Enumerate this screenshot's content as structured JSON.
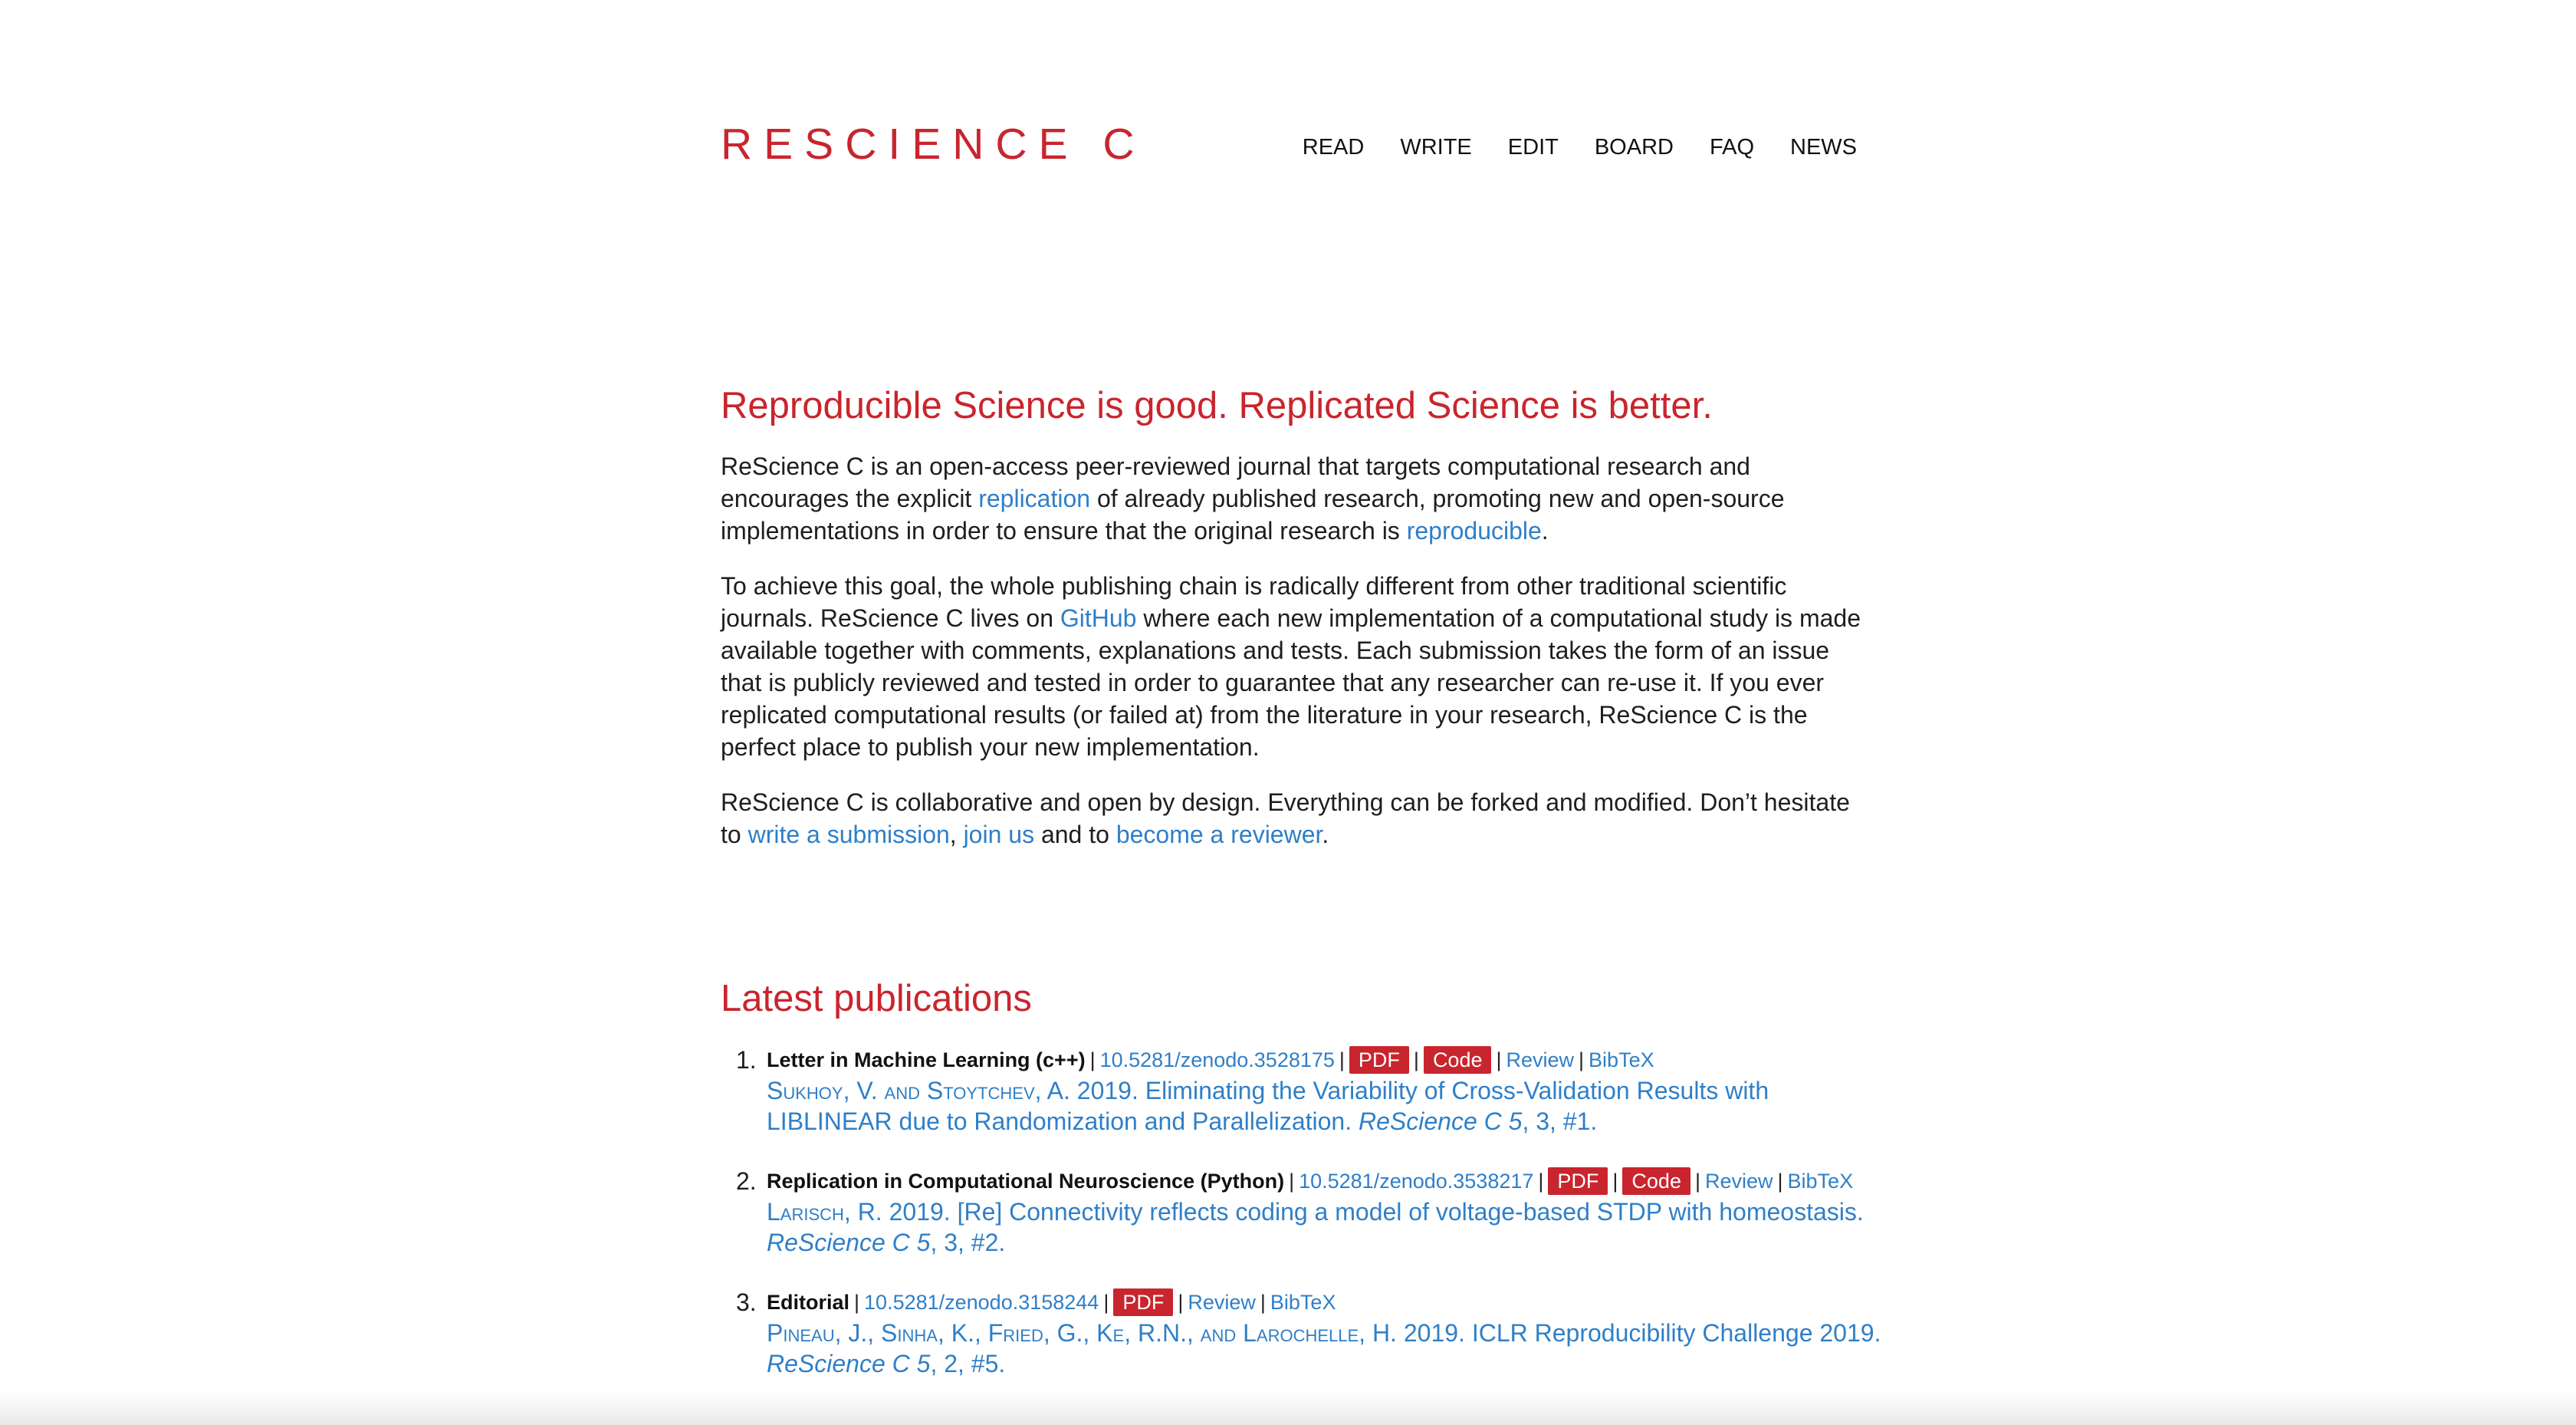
{
  "header": {
    "logo": "RESCIENCE C",
    "nav": [
      "READ",
      "WRITE",
      "EDIT",
      "BOARD",
      "FAQ",
      "NEWS"
    ]
  },
  "intro": {
    "title": "Reproducible Science is good. Replicated Science is better.",
    "p1": {
      "t1": "ReScience C is an open-access peer-reviewed journal that targets computational research and encourages the explicit ",
      "link1": "replication",
      "t2": " of already published research, promoting new and open-source implementations in order to ensure that the original research is ",
      "link2": "reproducible",
      "t3": "."
    },
    "p2": {
      "t1": "To achieve this goal, the whole publishing chain is radically different from other traditional scientific journals. ReScience C lives on ",
      "link1": "GitHub",
      "t2": " where each new implementation of a computational study is made available together with comments, explanations and tests. Each submission takes the form of an issue that is publicly reviewed and tested in order to guarantee that any researcher can re-use it. If you ever replicated computational results (or failed at) from the literature in your research, ReScience C is the perfect place to publish your new implementation."
    },
    "p3": {
      "t1": "ReScience C is collaborative and open by design. Everything can be forked and modified. Don’t hesitate to ",
      "link1": "write a submission",
      "t2": ", ",
      "link2": "join us",
      "t3": " and to ",
      "link3": "become a reviewer",
      "t4": "."
    }
  },
  "publications": {
    "title": "Latest publications",
    "items": [
      {
        "num": "1.",
        "category": "Letter in Machine Learning (c++)",
        "doi": "10.5281/zenodo.3528175",
        "pdf": "PDF",
        "code": "Code",
        "review": "Review",
        "bibtex": "BibTeX",
        "authors": "Sukhoy, V. and Stoytchev, A.",
        "year_title": " 2019. Eliminating the Variability of Cross-Validation Results with LIBLINEAR due to Randomization and Parallelization. ",
        "journal": "ReScience C 5",
        "issue": ", 3, #1."
      },
      {
        "num": "2.",
        "category": "Replication in Computational Neuroscience (Python)",
        "doi": "10.5281/zenodo.3538217",
        "pdf": "PDF",
        "code": "Code",
        "review": "Review",
        "bibtex": "BibTeX",
        "authors": "Larisch, R.",
        "year_title": " 2019. [Re] Connectivity reflects coding a model of voltage-based STDP with homeostasis. ",
        "journal": "ReScience C 5",
        "issue": ", 3, #2."
      },
      {
        "num": "3.",
        "category": "Editorial",
        "doi": "10.5281/zenodo.3158244",
        "pdf": "PDF",
        "review": "Review",
        "bibtex": "BibTeX",
        "authors": "Pineau, J., Sinha, K., Fried, G., Ke, R.N., and Larochelle, H.",
        "year_title": " 2019. ICLR Reproducibility Challenge 2019. ",
        "journal": "ReScience C 5",
        "issue": ", 2, #5."
      }
    ]
  }
}
